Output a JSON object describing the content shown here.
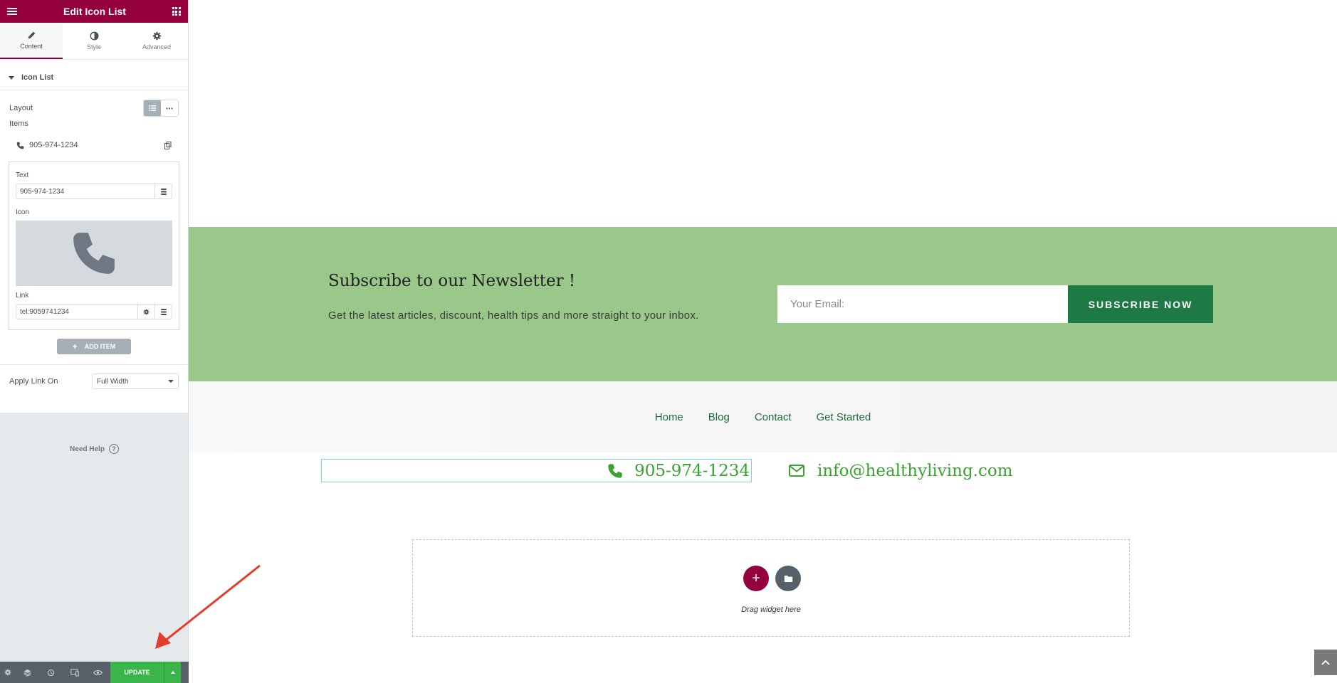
{
  "panel": {
    "title": "Edit Icon List",
    "tabs": [
      {
        "label": "Content",
        "icon": "pencil-icon"
      },
      {
        "label": "Style",
        "icon": "contrast-icon"
      },
      {
        "label": "Advanced",
        "icon": "gear-icon"
      }
    ],
    "section_title": "Icon List",
    "layout_label": "Layout",
    "items_label": "Items",
    "item": {
      "title": "905-974-1234",
      "text_label": "Text",
      "text_value": "905-974-1234",
      "icon_label": "Icon",
      "link_label": "Link",
      "link_value": "tel:9059741234"
    },
    "add_item_label": "ADD ITEM",
    "apply_link_label": "Apply Link On",
    "apply_link_value": "Full Width",
    "need_help_label": "Need Help",
    "update_label": "UPDATE"
  },
  "newsletter": {
    "title": "Subscribe to our Newsletter !",
    "subtitle": "Get the latest articles, discount, health tips and more straight to your inbox.",
    "email_placeholder": "Your Email:",
    "button_label": "SUBSCRIBE NOW"
  },
  "nav": {
    "items": [
      "Home",
      "Blog",
      "Contact",
      "Get Started"
    ]
  },
  "contact": {
    "phone": "905-974-1234",
    "email": "info@healthyliving.com"
  },
  "dropzone": {
    "text": "Drag widget here"
  },
  "colors": {
    "brand": "#93003c",
    "newsletter_bg": "#99c88a",
    "subscribe_btn": "#1e7a45",
    "contact_green": "#39a332",
    "update_green": "#39b54a"
  }
}
